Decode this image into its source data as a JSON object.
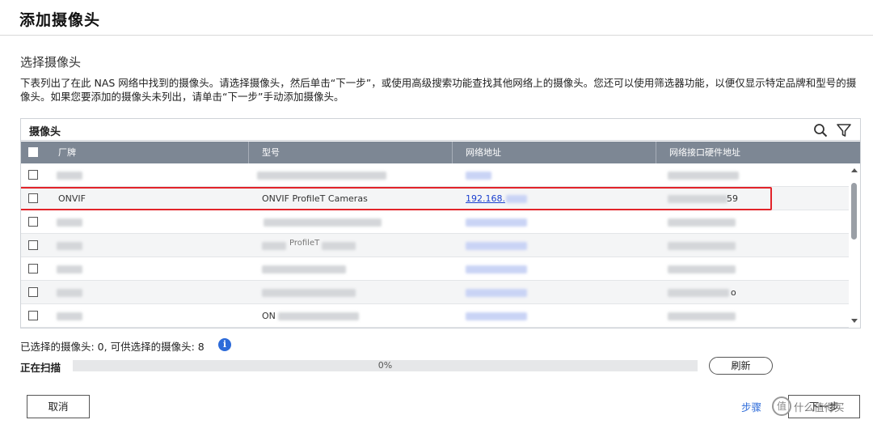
{
  "dialog": {
    "title": "添加摄像头"
  },
  "section": {
    "title": "选择摄像头",
    "description": "下表列出了在此 NAS 网络中找到的摄像头。请选择摄像头，然后单击“下一步”，或使用高级搜索功能查找其他网络上的摄像头。您还可以使用筛选器功能，以便仅显示特定品牌和型号的摄像头。如果您要添加的摄像头未列出，请单击“下一步”手动添加摄像头。"
  },
  "table": {
    "title": "摄像头",
    "columns": [
      "厂牌",
      "型号",
      "网络地址",
      "网络接口硬件地址"
    ],
    "rows": [
      {
        "brand": "",
        "model": "",
        "ip": "",
        "mac": ""
      },
      {
        "brand": "ONVIF",
        "model": "ONVIF ProfileT Cameras",
        "ip": "192.168.",
        "mac": "59"
      },
      {
        "brand": "",
        "model": "",
        "ip": "",
        "mac": ""
      },
      {
        "brand": "",
        "model": "ProfileT",
        "ip": "",
        "mac": ""
      },
      {
        "brand": "",
        "model": "",
        "ip": "",
        "mac": ""
      },
      {
        "brand": "",
        "model": "",
        "ip": "",
        "mac": "o"
      },
      {
        "brand": "",
        "model": "ON",
        "ip": "",
        "mac": ""
      }
    ]
  },
  "selection": {
    "summary": "已选择的摄像头:  0, 可供选择的摄像头:  8"
  },
  "scan": {
    "label": "正在扫描",
    "progress_text": "0%",
    "progress": 0,
    "refresh_label": "刷新"
  },
  "footer": {
    "cancel_label": "取消",
    "step_label": "步骤",
    "next_label": "下一步",
    "watermark_text": "什么值得买"
  },
  "colors": {
    "header_bg": "#7d8794",
    "highlight": "#e2242a",
    "link": "#1a3fcf",
    "info": "#2d6bd9"
  },
  "icons": [
    "search-icon",
    "filter-icon",
    "info-icon",
    "checkbox-icon"
  ]
}
